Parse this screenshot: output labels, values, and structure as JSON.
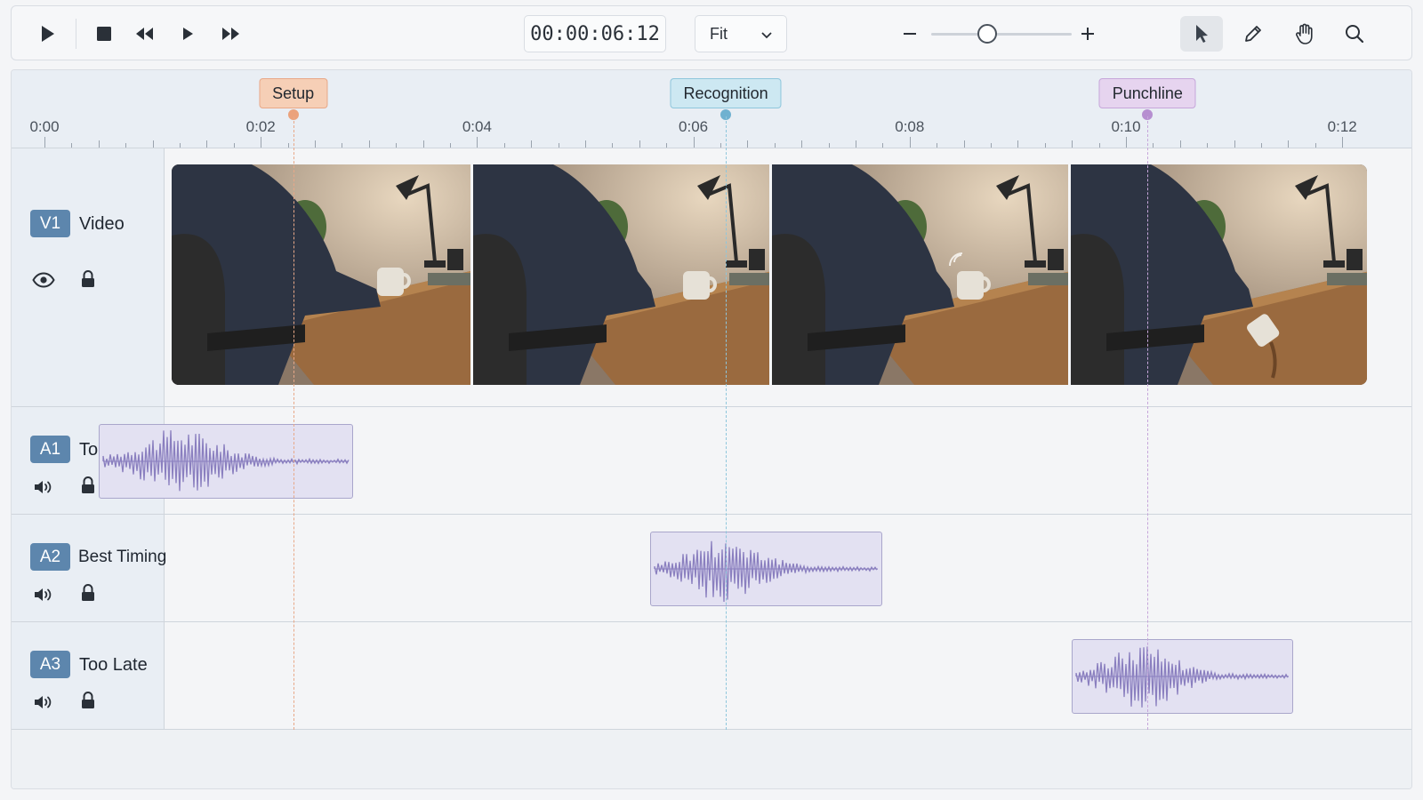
{
  "toolbar": {
    "play_icon": "play-icon",
    "stop_icon": "stop-icon",
    "rewind_icon": "rewind-icon",
    "step_icon": "step-forward-icon",
    "fastforward_icon": "fast-forward-icon",
    "timecode": "00:00:06:12",
    "fit_value": "Fit",
    "zoom_minus": "−",
    "zoom_plus": "+",
    "zoom_level": 0.4,
    "tools": [
      "select-arrow-icon",
      "pencil-icon",
      "hand-icon",
      "search-icon"
    ],
    "active_tool": "select"
  },
  "ruler": {
    "ticks": [
      {
        "label": "0:00",
        "t": 0
      },
      {
        "label": "0:02",
        "t": 2
      },
      {
        "label": "0:04",
        "t": 4
      },
      {
        "label": "0:06",
        "t": 6
      },
      {
        "label": "0:08",
        "t": 8
      },
      {
        "label": "0:10",
        "t": 10
      },
      {
        "label": "0:12",
        "t": 12
      }
    ]
  },
  "markers": [
    {
      "label": "Setup",
      "t": 2.3,
      "color": "#f6cfb6",
      "border": "#e8a888",
      "dot": "#eba27c",
      "line": "#e8a888"
    },
    {
      "label": "Recognition",
      "t": 6.3,
      "color": "#cde8f2",
      "border": "#8ec6dc",
      "dot": "#6fb1d0",
      "line": "#8ec6dc"
    },
    {
      "label": "Punchline",
      "t": 10.2,
      "color": "#e6d4ef",
      "border": "#c6a6da",
      "dot": "#b68ed0",
      "line": "#c6a6da"
    }
  ],
  "tracks": {
    "video": {
      "badge": "V1",
      "name": "Video",
      "eye_icon": "eye-icon",
      "lock_icon": "lock-icon"
    },
    "audio": [
      {
        "badge": "A1",
        "name": "Too Early",
        "speaker_icon": "speaker-icon",
        "lock_icon": "lock-icon",
        "clip_start": 0.5,
        "clip_end": 2.85
      },
      {
        "badge": "A2",
        "name": "Best Timing",
        "speaker_icon": "speaker-icon",
        "lock_icon": "lock-icon",
        "clip_start": 5.6,
        "clip_end": 7.75
      },
      {
        "badge": "A3",
        "name": "Too Late",
        "speaker_icon": "speaker-icon",
        "lock_icon": "lock-icon",
        "clip_start": 9.5,
        "clip_end": 11.55
      }
    ]
  },
  "video_frames": 4,
  "colors": {
    "badge": "#5d86ad",
    "clip_fill": "#e3e1f2",
    "waveform": "#8a7fbf"
  }
}
